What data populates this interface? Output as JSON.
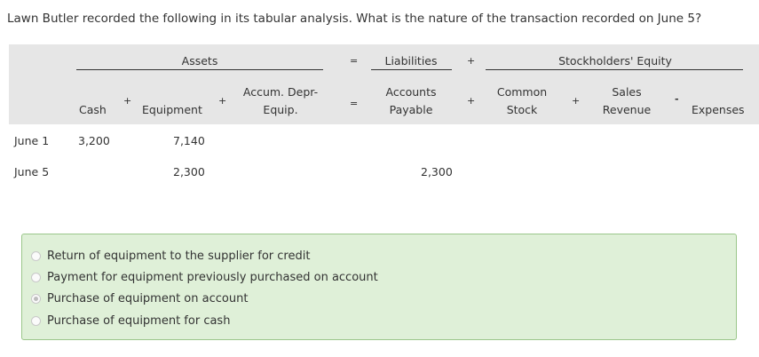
{
  "question": "Lawn Butler recorded the following in its tabular analysis. What is the nature of the transaction recorded on June 5?",
  "table": {
    "groups": {
      "assets": "Assets",
      "liabilities": "Liabilities",
      "equity": "Stockholders' Equity"
    },
    "ops": {
      "eq1": "=",
      "eq2": "=",
      "plus1": "+",
      "plus2": "+",
      "plus3": "+",
      "plus4": "+",
      "plus5": "+",
      "minus": "-"
    },
    "columns": {
      "cash": "Cash",
      "equipment": "Equipment",
      "accum_line1": "Accum. Depr-",
      "accum_line2": "Equip.",
      "ap_line1": "Accounts",
      "ap_line2": "Payable",
      "cs_line1": "Common",
      "cs_line2": "Stock",
      "sr_line1": "Sales",
      "sr_line2": "Revenue",
      "expenses": "Expenses"
    },
    "rows": [
      {
        "label": "June 1",
        "cash": "3,200",
        "equipment": "7,140",
        "accounts_payable": ""
      },
      {
        "label": "June 5",
        "cash": "",
        "equipment": "2,300",
        "accounts_payable": "2,300"
      }
    ]
  },
  "options": [
    {
      "text": "Return of equipment to the supplier for credit",
      "selected": false
    },
    {
      "text": "Payment for equipment previously purchased on account",
      "selected": false
    },
    {
      "text": "Purchase of equipment on account",
      "selected": true
    },
    {
      "text": "Purchase of equipment for cash",
      "selected": false
    }
  ]
}
